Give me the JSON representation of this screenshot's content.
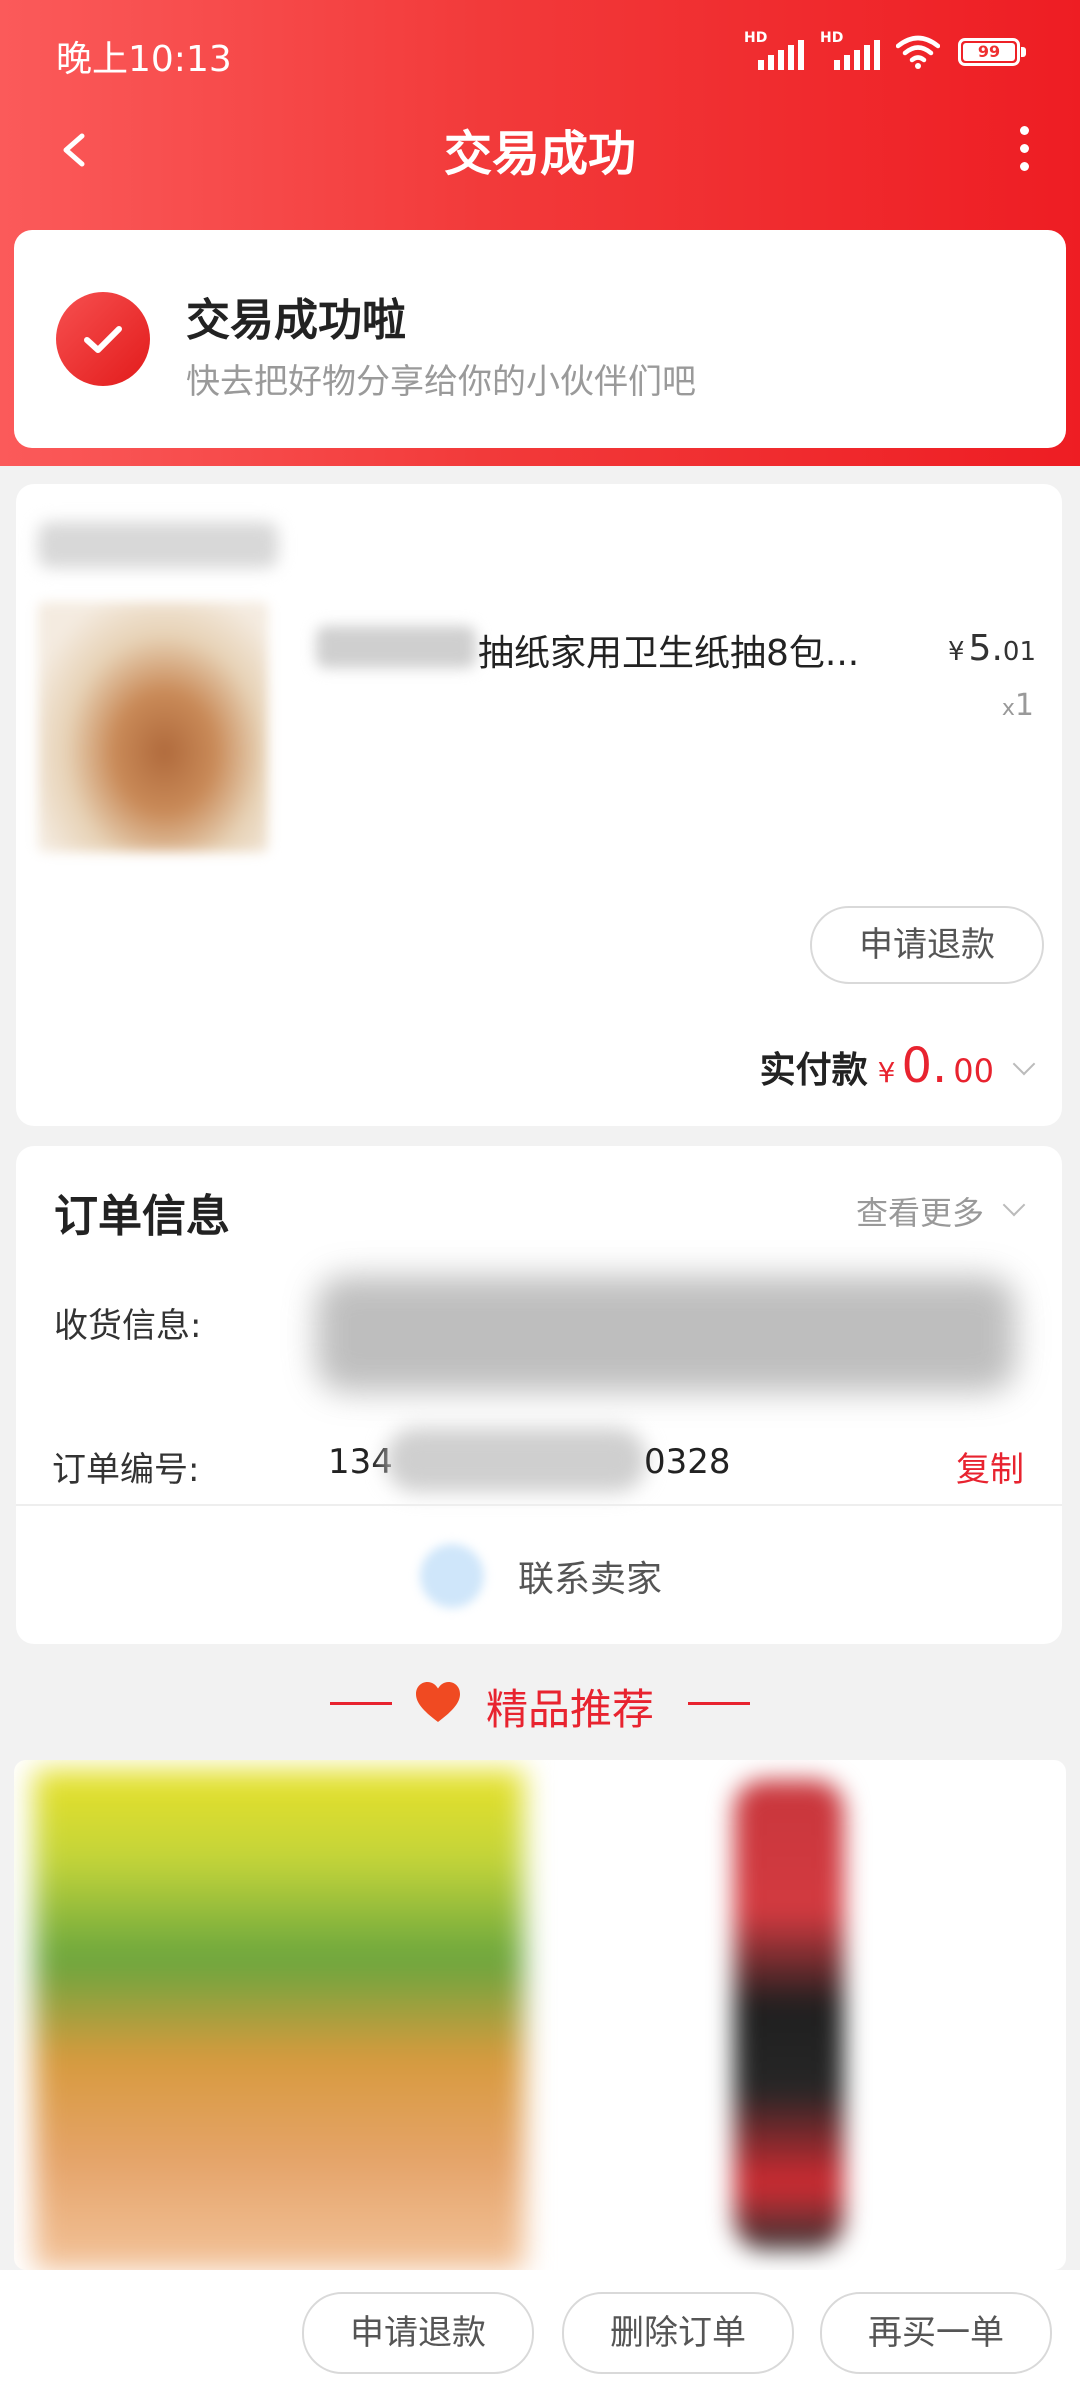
{
  "status_bar": {
    "time": "晚上10:13",
    "network_label_1": "HD",
    "network_label_2": "HD",
    "battery": "99"
  },
  "nav": {
    "title": "交易成功",
    "back_icon": "chevron-left-icon",
    "more_icon": "more-vertical-icon"
  },
  "success": {
    "title": "交易成功啦",
    "subtitle": "快去把好物分享给你的小伙伴们吧",
    "icon": "check-circle-icon"
  },
  "product": {
    "title": "抽纸家用卫生纸抽8包...",
    "price_currency": "¥",
    "price_int": "5.",
    "price_dec": "01",
    "qty_prefix": "x",
    "qty": "1",
    "refund_label": "申请退款",
    "paid_label": "实付款",
    "paid_currency": "¥",
    "paid_int": "0.",
    "paid_dec": "00"
  },
  "order": {
    "title": "订单信息",
    "see_more": "查看更多",
    "address_label": "收货信息:",
    "order_no_label": "订单编号:",
    "order_no_head": "134",
    "order_no_tail": "0328",
    "copy_label": "复制",
    "contact_label": "联系卖家"
  },
  "recommend": {
    "title": "精品推荐",
    "icon": "heart-icon"
  },
  "bottom_bar": {
    "refund": "申请退款",
    "delete": "删除订单",
    "rebuy": "再买一单"
  },
  "colors": {
    "brand_red": "#ee1d23",
    "price_red": "#e8232f"
  }
}
